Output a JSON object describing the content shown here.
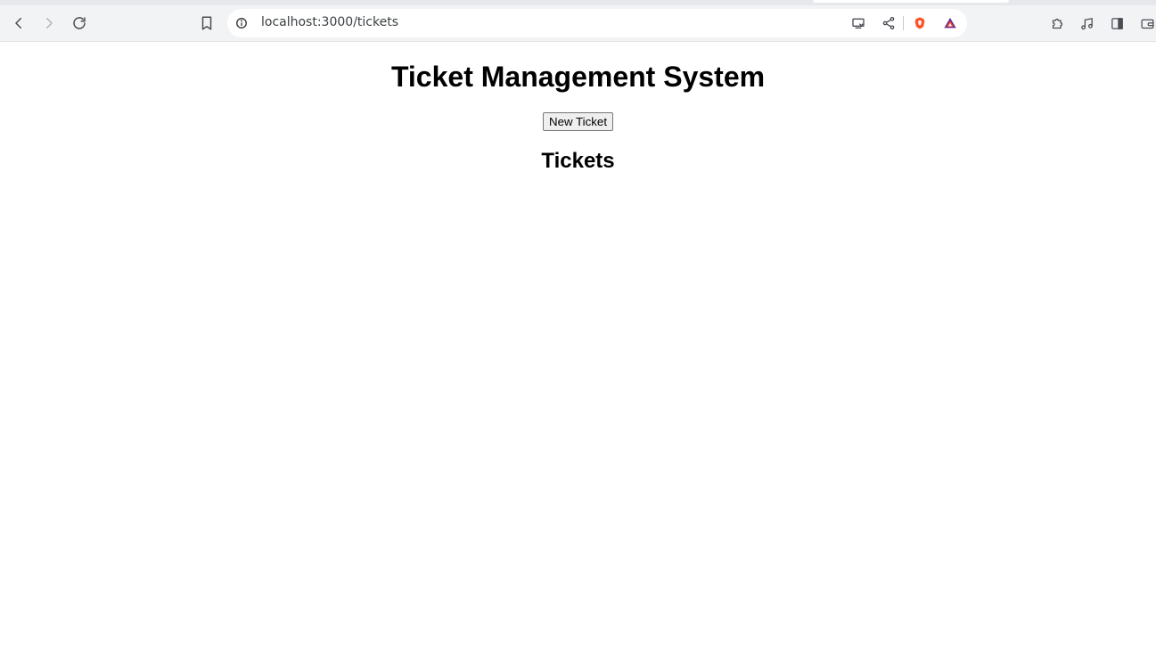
{
  "browser": {
    "url": "localhost:3000/tickets",
    "icons": {
      "back": "chevron-left-icon",
      "forward": "chevron-right-icon",
      "reload": "reload-icon",
      "bookmark": "bookmark-icon",
      "site_info": "info-circle-icon",
      "cast": "cast-icon",
      "share": "share-icon",
      "shield": "brave-shield-icon",
      "rewards": "brave-rewards-icon",
      "extensions": "puzzle-icon",
      "media": "music-note-icon",
      "sidebar": "sidebar-icon",
      "wallet": "wallet-icon"
    },
    "colors": {
      "chrome_bg": "#f1f3f5",
      "shield_orange": "#fb542b",
      "rewards_purple": "#662d91"
    }
  },
  "page": {
    "title": "Ticket Management System",
    "new_ticket_label": "New Ticket",
    "tickets_heading": "Tickets"
  }
}
